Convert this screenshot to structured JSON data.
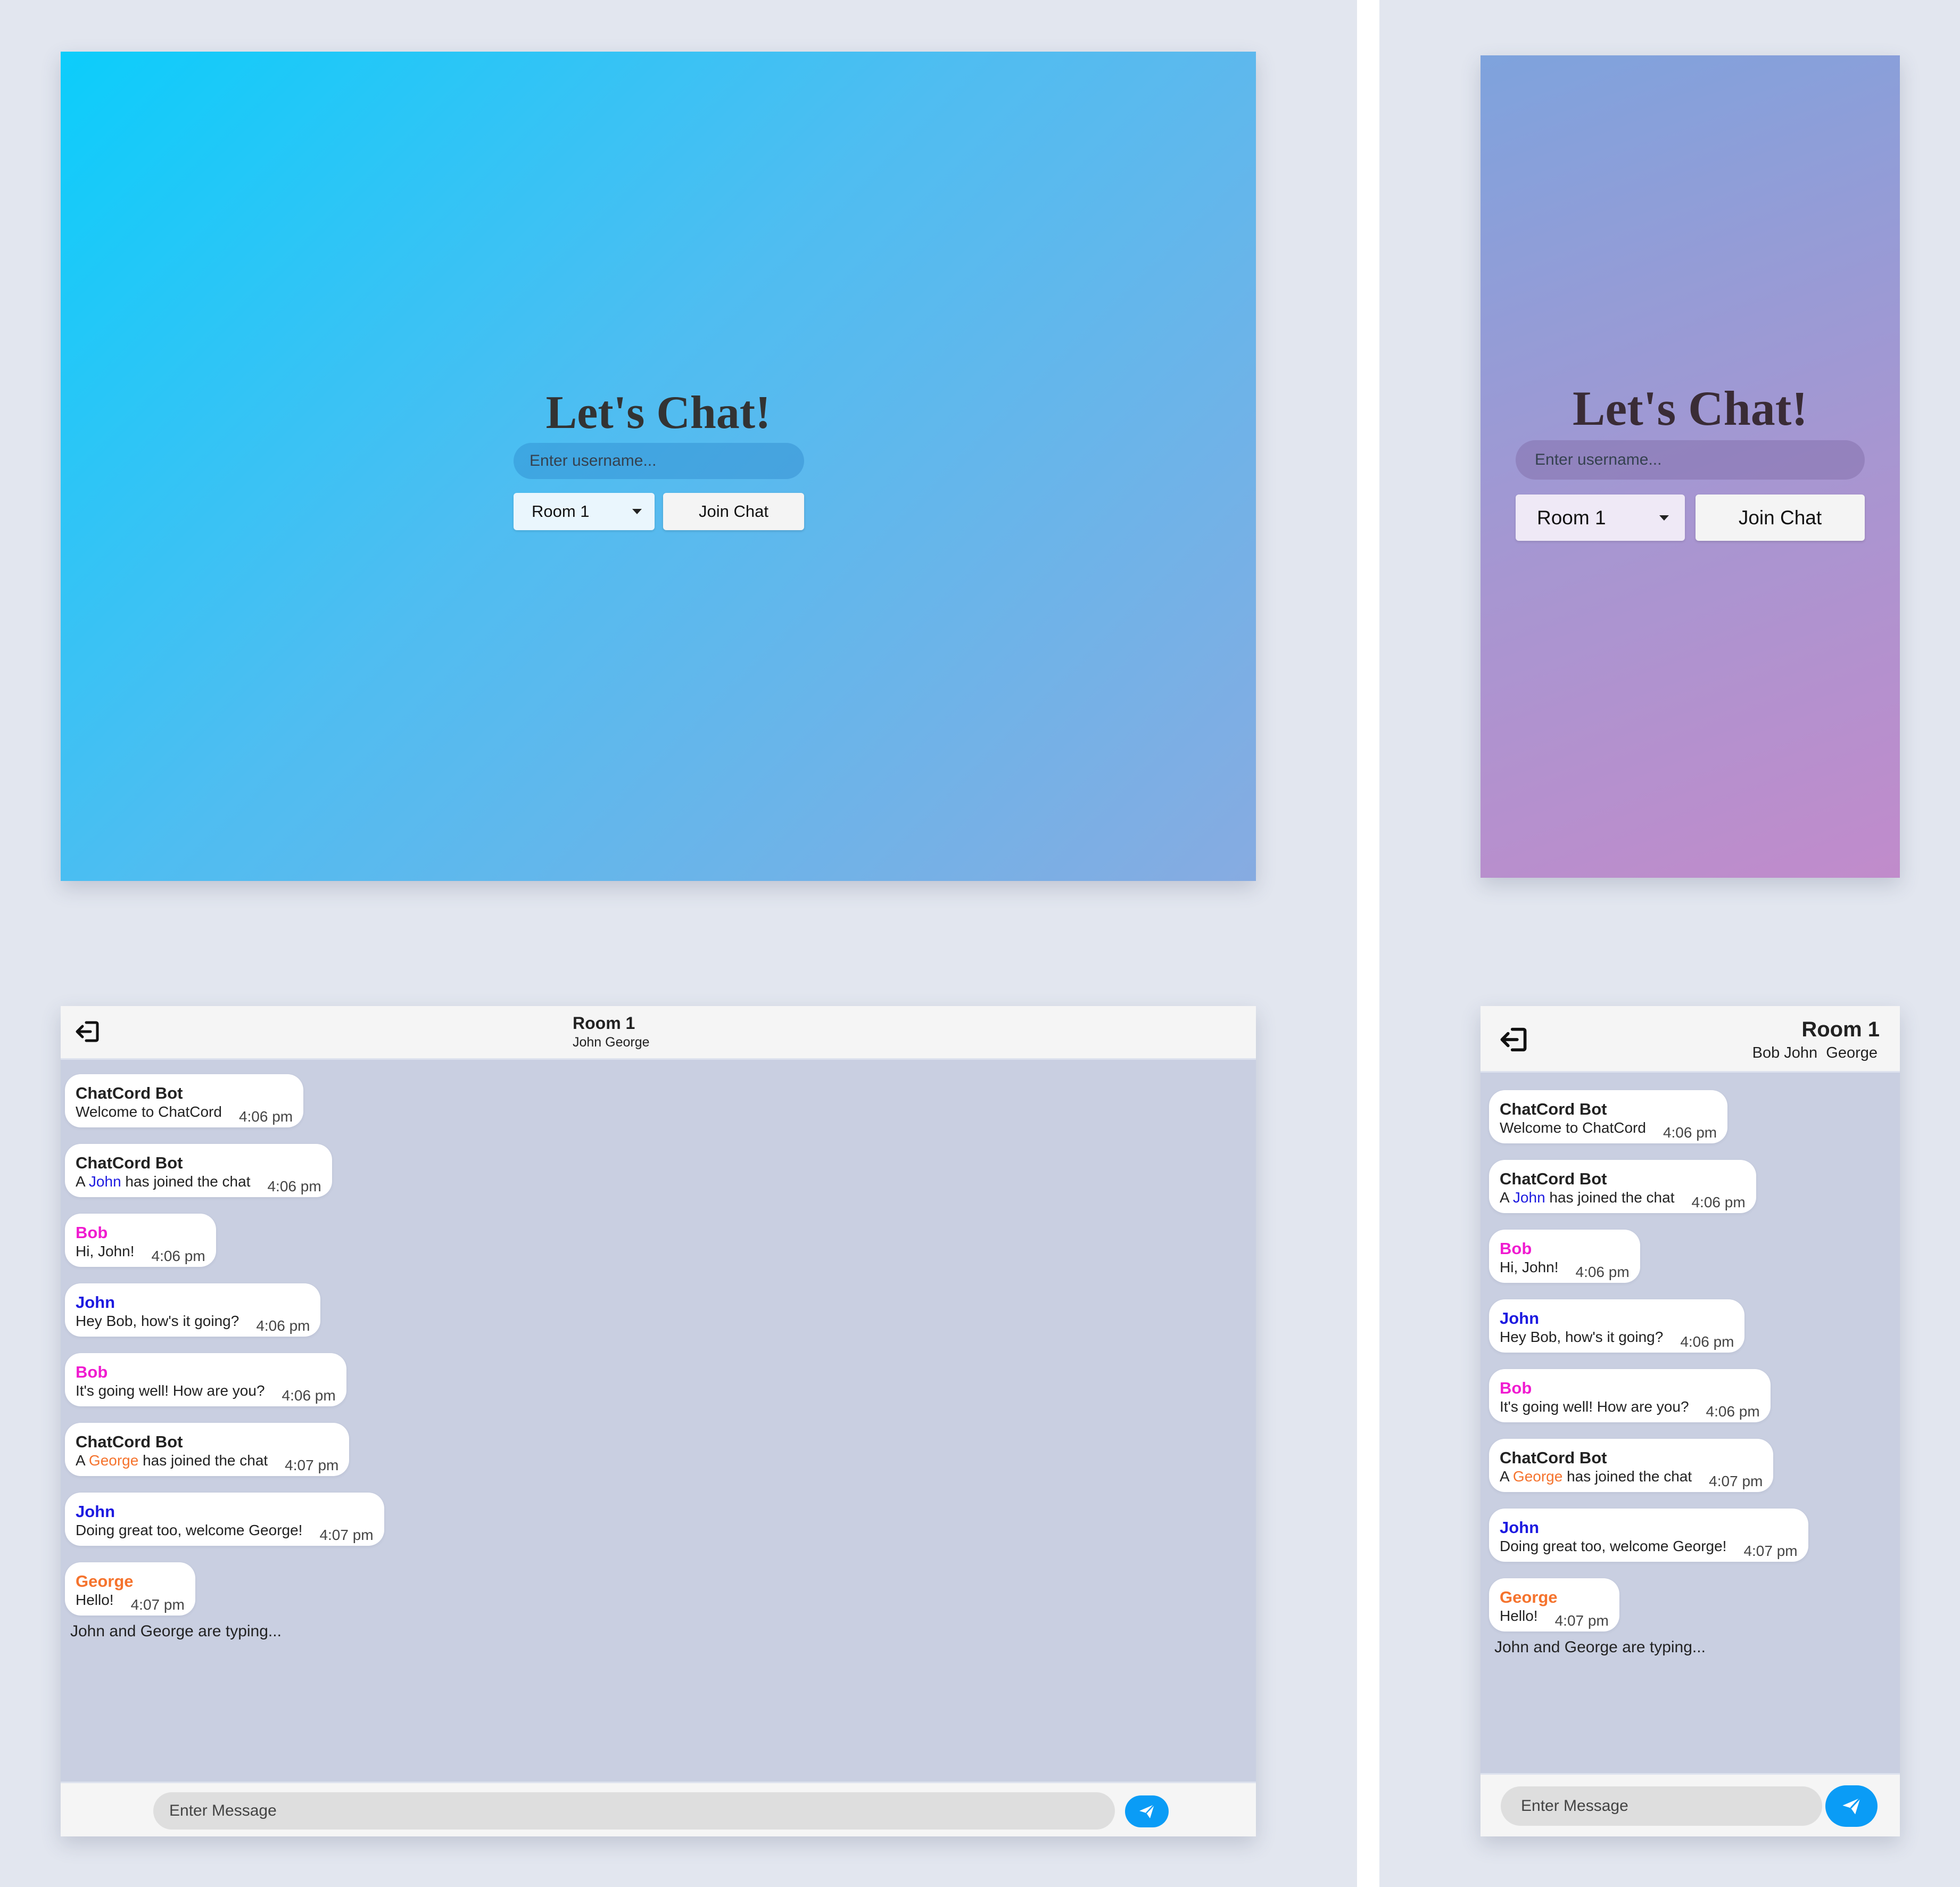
{
  "login": {
    "title": "Let's Chat!",
    "username_placeholder": "Enter username...",
    "room_selected": "Room 1",
    "join_label": "Join Chat"
  },
  "colors": {
    "bot": "#222222",
    "bob": "#f01bd0",
    "john": "#1d1ae0",
    "george": "#f5732d",
    "send_button": "#0a9cf6"
  },
  "chat_desktop": {
    "room_name": "Room 1",
    "users": "John George",
    "input_placeholder": "Enter Message",
    "typing": "John and George are typing..."
  },
  "chat_mobile": {
    "room_name": "Room 1",
    "users": "Bob John  George",
    "input_placeholder": "Enter Message",
    "typing": "John and George are typing..."
  },
  "messages": [
    {
      "sender": "ChatCord Bot",
      "text": "Welcome to ChatCord",
      "time": "4:06 pm"
    },
    {
      "sender": "ChatCord Bot",
      "pre": "A ",
      "mention": "John",
      "post": " has joined the chat",
      "time": "4:06 pm"
    },
    {
      "sender": "Bob",
      "text": "Hi, John!",
      "time": "4:06 pm"
    },
    {
      "sender": "John",
      "text": "Hey Bob, how's it going?",
      "time": "4:06 pm"
    },
    {
      "sender": "Bob",
      "text": "It's going well! How are you?",
      "time": "4:06 pm"
    },
    {
      "sender": "ChatCord Bot",
      "pre": "A ",
      "mention": "George",
      "post": " has joined the chat",
      "time": "4:07 pm"
    },
    {
      "sender": "John",
      "text": "Doing great too, welcome George!",
      "time": "4:07 pm"
    },
    {
      "sender": "George",
      "text": "Hello!",
      "time": "4:07 pm"
    }
  ]
}
